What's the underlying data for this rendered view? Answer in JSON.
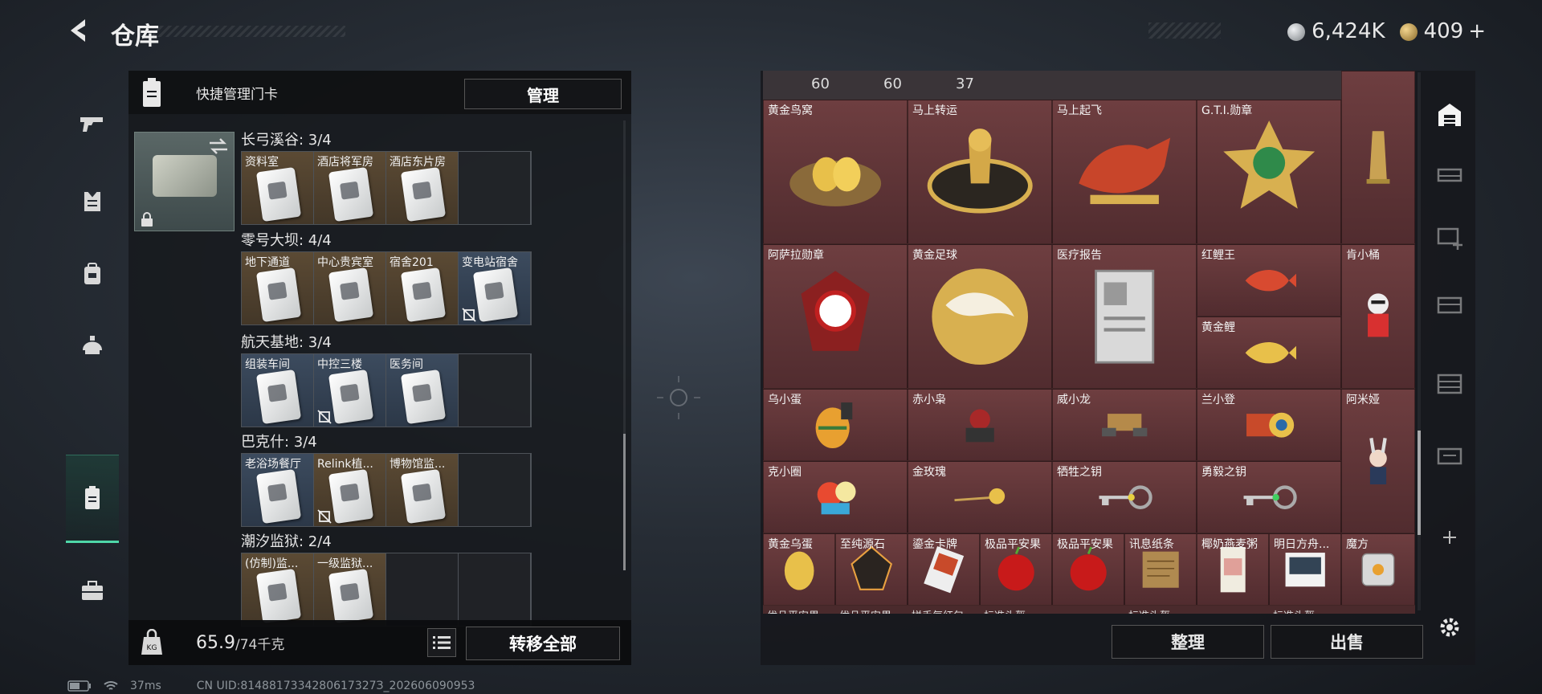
{
  "header": {
    "title": "仓库",
    "currency": [
      {
        "icon": "silver-coin-icon",
        "value": "6,424K",
        "color": "#bfc3c7"
      },
      {
        "icon": "gold-coin-icon",
        "value": "409",
        "plus": "+",
        "color": "#c9a253"
      }
    ]
  },
  "left_nav": {
    "items": [
      {
        "name": "weapons",
        "icon": "gun-icon"
      },
      {
        "name": "armor",
        "icon": "armor-vest-icon"
      },
      {
        "name": "backpack",
        "icon": "backpack-icon"
      },
      {
        "name": "helmet",
        "icon": "helmet-icon"
      },
      {
        "name": "keycards",
        "icon": "keycard-icon",
        "active": true
      },
      {
        "name": "toolbox",
        "icon": "toolbox-icon"
      }
    ],
    "accent": "#4fd7a8"
  },
  "quick_manage": {
    "label": "快捷管理门卡",
    "manage_button": "管理"
  },
  "zones": [
    {
      "title": "长弓溪谷: 3/4",
      "keys": [
        {
          "label": "资料室",
          "rarity": "gold"
        },
        {
          "label": "酒店将军房",
          "rarity": "gold"
        },
        {
          "label": "酒店东片房",
          "rarity": "gold"
        },
        {
          "label": "",
          "rarity": "empty"
        }
      ]
    },
    {
      "title": "零号大坝: 4/4",
      "keys": [
        {
          "label": "地下通道",
          "rarity": "gold"
        },
        {
          "label": "中心贵宾室",
          "rarity": "gold"
        },
        {
          "label": "宿舍201",
          "rarity": "gold"
        },
        {
          "label": "变电站宿舍",
          "rarity": "blue",
          "nonreturnable": true
        }
      ]
    },
    {
      "title": "航天基地: 3/4",
      "keys": [
        {
          "label": "组装车间",
          "rarity": "blue"
        },
        {
          "label": "中控三楼",
          "rarity": "blue",
          "nonreturnable": true
        },
        {
          "label": "医务间",
          "rarity": "blue"
        },
        {
          "label": "",
          "rarity": "empty"
        }
      ]
    },
    {
      "title": "巴克什: 3/4",
      "keys": [
        {
          "label": "老浴场餐厅",
          "rarity": "blue"
        },
        {
          "label": "Relink植...",
          "rarity": "gold",
          "nonreturnable": true
        },
        {
          "label": "博物馆监...",
          "rarity": "gold"
        },
        {
          "label": "",
          "rarity": "empty"
        }
      ]
    },
    {
      "title": "潮汐监狱: 2/4",
      "keys": [
        {
          "label": "(仿制)监...",
          "rarity": "gold"
        },
        {
          "label": "一级监狱...",
          "rarity": "gold"
        },
        {
          "label": "",
          "rarity": "empty"
        },
        {
          "label": "",
          "rarity": "empty"
        }
      ]
    }
  ],
  "weight": {
    "current": "65.9",
    "capacity": "/74千克"
  },
  "transfer_all": "转移全部",
  "status_bar": {
    "ping": "37ms",
    "uid": "CN UID:8148817334280617327З_202606090953"
  },
  "inventory_top_numbers": [
    "60",
    "60",
    "37"
  ],
  "inventory": [
    {
      "label": "黄金鸟窝",
      "icon": "golden-nest-icon"
    },
    {
      "label": "马上转运",
      "icon": "horse-wheel-icon"
    },
    {
      "label": "马上起飞",
      "icon": "red-horse-icon"
    },
    {
      "label": "G.T.I.勋章",
      "icon": "gti-medal-icon"
    },
    {
      "label": "",
      "icon": "golden-pillar-icon"
    },
    {
      "label": "阿萨拉勋章",
      "icon": "asala-medal-icon"
    },
    {
      "label": "黄金足球",
      "icon": "golden-football-icon"
    },
    {
      "label": "医疗报告",
      "icon": "medical-report-icon"
    },
    {
      "label": "红鲤王",
      "icon": "red-koi-icon"
    },
    {
      "label": "黄金鲤",
      "icon": "golden-koi-icon"
    },
    {
      "label": "肯小桶",
      "icon": "kfc-figure-icon"
    },
    {
      "label": "乌小蛋",
      "icon": "egg-figure-icon"
    },
    {
      "label": "赤小枭",
      "icon": "red-figure-icon"
    },
    {
      "label": "威小龙",
      "icon": "mech-figure-icon"
    },
    {
      "label": "兰小登",
      "icon": "robot-figure-icon"
    },
    {
      "label": "阿米娅",
      "icon": "amiya-figure-icon"
    },
    {
      "label": "克小圈",
      "icon": "clown-figure-icon"
    },
    {
      "label": "金玫瑰",
      "icon": "golden-rose-icon"
    },
    {
      "label": "牺牲之钥",
      "icon": "sacrifice-key-icon"
    },
    {
      "label": "勇毅之钥",
      "icon": "courage-key-icon"
    },
    {
      "label": "黄金乌蛋",
      "icon": "golden-egg-icon"
    },
    {
      "label": "至纯源石",
      "icon": "originium-icon"
    },
    {
      "label": "鎏金卡牌",
      "icon": "gilded-card-icon"
    },
    {
      "label": "极品平安果",
      "icon": "apple-icon"
    },
    {
      "label": "极品平安果",
      "icon": "apple-icon"
    },
    {
      "label": "讯息纸条",
      "icon": "paper-note-icon"
    },
    {
      "label": "椰奶燕麦粥",
      "icon": "oat-box-icon"
    },
    {
      "label": "明日方舟...",
      "icon": "arknights-card-icon"
    },
    {
      "label": "魔方",
      "icon": "cube-icon"
    }
  ],
  "inventory_bottom_partial": [
    "优品平安果",
    "优品平安果",
    "拼手气红包",
    "标准头盔",
    "标准头盔",
    "标准头盔"
  ],
  "organize_button": "整理",
  "sell_button": "出售",
  "right_nav": [
    {
      "icon": "warehouse-icon",
      "active": true
    },
    {
      "icon": "storage-icon"
    },
    {
      "icon": "storage-add-icon"
    },
    {
      "icon": "storage-tab-3-icon"
    },
    {
      "icon": "storage-tab-4-icon"
    },
    {
      "icon": "storage-tab-5-icon"
    },
    {
      "icon": "plus-icon"
    },
    {
      "icon": "gear-icon"
    }
  ]
}
